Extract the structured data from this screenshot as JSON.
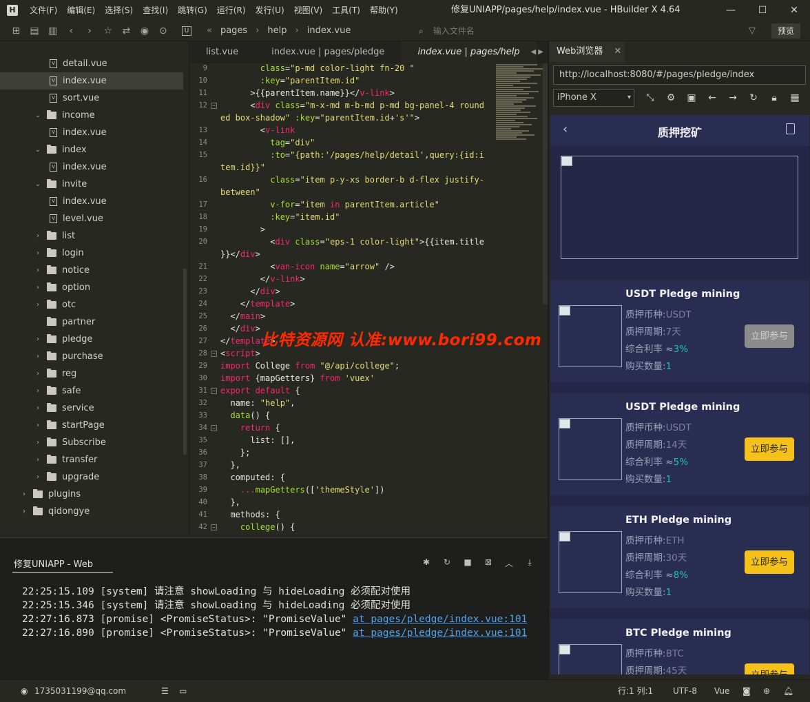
{
  "window": {
    "logo": "H",
    "title": "修复UNIAPP/pages/help/index.vue - HBuilder X 4.64",
    "menu": [
      "文件(F)",
      "编辑(E)",
      "选择(S)",
      "查找(I)",
      "跳转(G)",
      "运行(R)",
      "发行(U)",
      "视图(V)",
      "工具(T)",
      "帮助(Y)"
    ],
    "controls": [
      "—",
      "☐",
      "✕"
    ]
  },
  "toolbar": {
    "breadcrumb": [
      "pages",
      "help",
      "index.vue"
    ],
    "file_search_placeholder": "输入文件名",
    "preview_label": "预览"
  },
  "sidebar": {
    "tree": [
      {
        "label": "detail.vue",
        "type": "file",
        "depth": 3
      },
      {
        "label": "index.vue",
        "type": "file",
        "depth": 3,
        "selected": true
      },
      {
        "label": "sort.vue",
        "type": "file",
        "depth": 3
      },
      {
        "label": "income",
        "type": "folder",
        "depth": 2,
        "open": true
      },
      {
        "label": "index.vue",
        "type": "file",
        "depth": 3
      },
      {
        "label": "index",
        "type": "folder",
        "depth": 2,
        "open": true
      },
      {
        "label": "index.vue",
        "type": "file",
        "depth": 3
      },
      {
        "label": "invite",
        "type": "folder",
        "depth": 2,
        "open": true
      },
      {
        "label": "index.vue",
        "type": "file",
        "depth": 3
      },
      {
        "label": "level.vue",
        "type": "file",
        "depth": 3
      },
      {
        "label": "list",
        "type": "folder",
        "depth": 2
      },
      {
        "label": "login",
        "type": "folder",
        "depth": 2
      },
      {
        "label": "notice",
        "type": "folder",
        "depth": 2
      },
      {
        "label": "option",
        "type": "folder",
        "depth": 2
      },
      {
        "label": "otc",
        "type": "folder",
        "depth": 2
      },
      {
        "label": "partner",
        "type": "folder",
        "depth": 2,
        "nochev": true
      },
      {
        "label": "pledge",
        "type": "folder",
        "depth": 2
      },
      {
        "label": "purchase",
        "type": "folder",
        "depth": 2
      },
      {
        "label": "reg",
        "type": "folder",
        "depth": 2
      },
      {
        "label": "safe",
        "type": "folder",
        "depth": 2
      },
      {
        "label": "service",
        "type": "folder",
        "depth": 2
      },
      {
        "label": "startPage",
        "type": "folder",
        "depth": 2
      },
      {
        "label": "Subscribe",
        "type": "folder",
        "depth": 2
      },
      {
        "label": "transfer",
        "type": "folder",
        "depth": 2
      },
      {
        "label": "upgrade",
        "type": "folder",
        "depth": 2
      },
      {
        "label": "plugins",
        "type": "folder",
        "depth": 1
      },
      {
        "label": "qidongye",
        "type": "folder",
        "depth": 1
      }
    ]
  },
  "editor": {
    "tabs": [
      "list.vue",
      "index.vue | pages/pledge",
      "index.vue | pages/help"
    ],
    "watermark": "比特资源网 认准:www.bori99.com"
  },
  "console": {
    "tab_label": "修复UNIAPP - Web",
    "lines": [
      {
        "text": "22:25:15.109 [system] 请注意 showLoading 与 hideLoading 必须配对使用",
        "link": ""
      },
      {
        "text": "22:25:15.346 [system] 请注意 showLoading 与 hideLoading 必须配对使用",
        "link": ""
      },
      {
        "text": "22:27:16.873 [promise] <PromiseStatus>: \"PromiseValue\" ",
        "link": "at pages/pledge/index.vue:101"
      },
      {
        "text": "22:27:16.890 [promise] <PromiseStatus>: \"PromiseValue\" ",
        "link": "at pages/pledge/index.vue:101"
      }
    ]
  },
  "statusbar": {
    "account": "1735031199@qq.com",
    "position": "行:1  列:1",
    "encoding": "UTF-8",
    "language": "Vue"
  },
  "browser": {
    "tab_label": "Web浏览器",
    "url": "http://localhost:8080/#/pages/pledge/index",
    "device": "iPhone X"
  },
  "app_page": {
    "title": "质押挖矿",
    "labels": {
      "currency": "质押币种:",
      "period": "质押周期:",
      "rate": "综合利率 ≈",
      "qty": "购买数量:"
    },
    "cards": [
      {
        "title": "USDT Pledge mining",
        "currency": "USDT",
        "period": "7天",
        "rate": "3%",
        "qty": "1",
        "button": "立即参与",
        "disabled": true
      },
      {
        "title": "USDT Pledge mining",
        "currency": "USDT",
        "period": "14天",
        "rate": "5%",
        "qty": "1",
        "button": "立即参与",
        "disabled": false
      },
      {
        "title": "ETH Pledge mining",
        "currency": "ETH",
        "period": "30天",
        "rate": "8%",
        "qty": "1",
        "button": "立即参与",
        "disabled": false
      },
      {
        "title": "BTC Pledge mining",
        "currency": "BTC",
        "period": "45天",
        "rate": "",
        "qty": "",
        "button": "立即参与",
        "disabled": false
      }
    ],
    "colors": {
      "bg": "#232645",
      "card": "#2a2d52",
      "accent": "#f6c21a",
      "green": "#23c4a5"
    }
  }
}
